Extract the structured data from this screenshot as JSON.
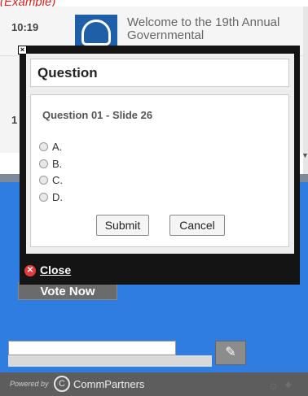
{
  "header": {
    "cut_label": "(Example)"
  },
  "background": {
    "items": [
      {
        "time": "10:19",
        "title": "Welcome to the 19th Annual Governmental"
      },
      {
        "time": "1"
      }
    ],
    "vote_now": "Vote Now",
    "attach_icon": "paperclip-icon"
  },
  "modal": {
    "title": "Question",
    "question": "Question 01 - Slide 26",
    "options": [
      "A.",
      "B.",
      "C.",
      "D."
    ],
    "submit": "Submit",
    "cancel": "Cancel",
    "close": "Close"
  },
  "footer": {
    "powered_by": "Powered by",
    "brand": "CommPartners"
  }
}
